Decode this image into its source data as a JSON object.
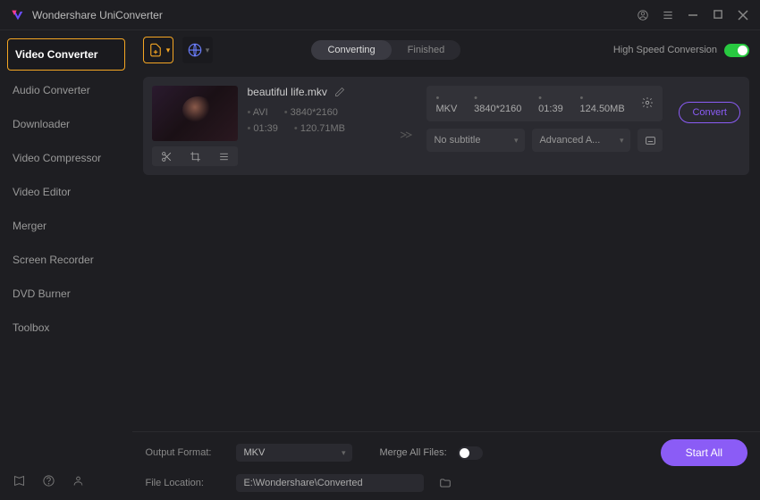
{
  "app": {
    "title": "Wondershare UniConverter"
  },
  "sidebar": {
    "items": [
      {
        "label": "Video Converter",
        "active": true
      },
      {
        "label": "Audio Converter"
      },
      {
        "label": "Downloader"
      },
      {
        "label": "Video Compressor"
      },
      {
        "label": "Video Editor"
      },
      {
        "label": "Merger"
      },
      {
        "label": "Screen Recorder"
      },
      {
        "label": "DVD Burner"
      },
      {
        "label": "Toolbox"
      }
    ]
  },
  "toolbar": {
    "tabs": {
      "converting": "Converting",
      "finished": "Finished"
    },
    "hsc_label": "High Speed Conversion",
    "hsc_on": true
  },
  "file": {
    "name": "beautiful life.mkv",
    "in": {
      "format": "AVI",
      "resolution": "3840*2160",
      "duration": "01:39",
      "size": "120.71MB"
    },
    "out": {
      "format": "MKV",
      "resolution": "3840*2160",
      "duration": "01:39",
      "size": "124.50MB"
    },
    "subtitle_select": "No subtitle",
    "audio_select": "Advanced A...",
    "convert_label": "Convert"
  },
  "bottom": {
    "output_format_label": "Output Format:",
    "output_format_value": "MKV",
    "merge_label": "Merge All Files:",
    "merge_on": false,
    "location_label": "File Location:",
    "location_value": "E:\\Wondershare\\Converted",
    "start_all": "Start All"
  }
}
